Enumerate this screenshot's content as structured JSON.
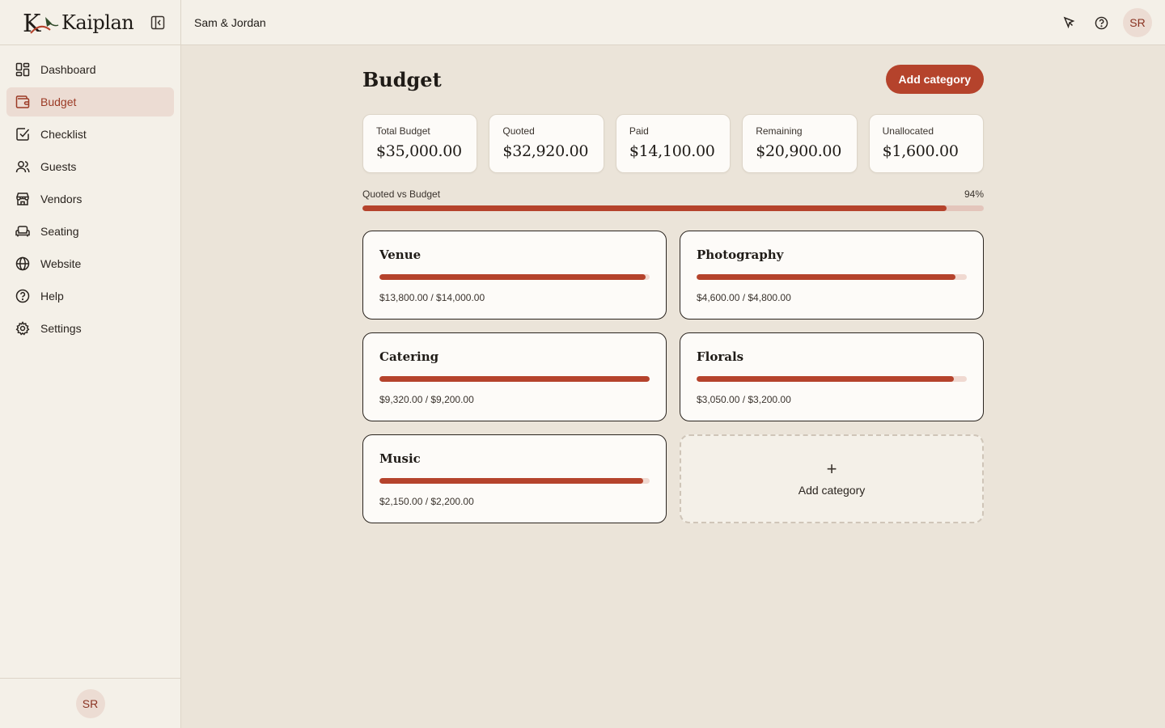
{
  "brand": {
    "name": "Kaiplan"
  },
  "sidebar": {
    "items": [
      {
        "label": "Dashboard",
        "icon": "dashboard-icon",
        "active": false
      },
      {
        "label": "Budget",
        "icon": "wallet-icon",
        "active": true
      },
      {
        "label": "Checklist",
        "icon": "checklist-icon",
        "active": false
      },
      {
        "label": "Guests",
        "icon": "users-icon",
        "active": false
      },
      {
        "label": "Vendors",
        "icon": "store-icon",
        "active": false
      },
      {
        "label": "Seating",
        "icon": "sofa-icon",
        "active": false
      },
      {
        "label": "Website",
        "icon": "globe-icon",
        "active": false
      },
      {
        "label": "Help",
        "icon": "help-icon",
        "active": false
      },
      {
        "label": "Settings",
        "icon": "gear-icon",
        "active": false
      }
    ],
    "footer_avatar": "SR"
  },
  "header": {
    "title": "Sam & Jordan",
    "avatar": "SR"
  },
  "main": {
    "title": "Budget",
    "add_category_label": "Add category",
    "stats": [
      {
        "label": "Total Budget",
        "value": "$35,000.00"
      },
      {
        "label": "Quoted",
        "value": "$32,920.00"
      },
      {
        "label": "Paid",
        "value": "$14,100.00"
      },
      {
        "label": "Remaining",
        "value": "$20,900.00"
      },
      {
        "label": "Unallocated",
        "value": "$1,600.00"
      }
    ],
    "progress": {
      "label": "Quoted vs Budget",
      "percent_label": "94%",
      "fraction": 0.94
    },
    "categories": [
      {
        "name": "Venue",
        "amount": "$13,800.00 / $14,000.00",
        "fraction": 0.986
      },
      {
        "name": "Photography",
        "amount": "$4,600.00 / $4,800.00",
        "fraction": 0.958
      },
      {
        "name": "Catering",
        "amount": "$9,320.00 / $9,200.00",
        "fraction": 1.0
      },
      {
        "name": "Florals",
        "amount": "$3,050.00 / $3,200.00",
        "fraction": 0.953
      },
      {
        "name": "Music",
        "amount": "$2,150.00 / $2,200.00",
        "fraction": 0.977
      }
    ],
    "add_card_label": "Add category",
    "add_card_plus": "+"
  },
  "colors": {
    "accent": "#b5432c",
    "accent_light": "#ecdcd3",
    "background": "#ebe4d9",
    "surface": "#f4f0e8"
  }
}
